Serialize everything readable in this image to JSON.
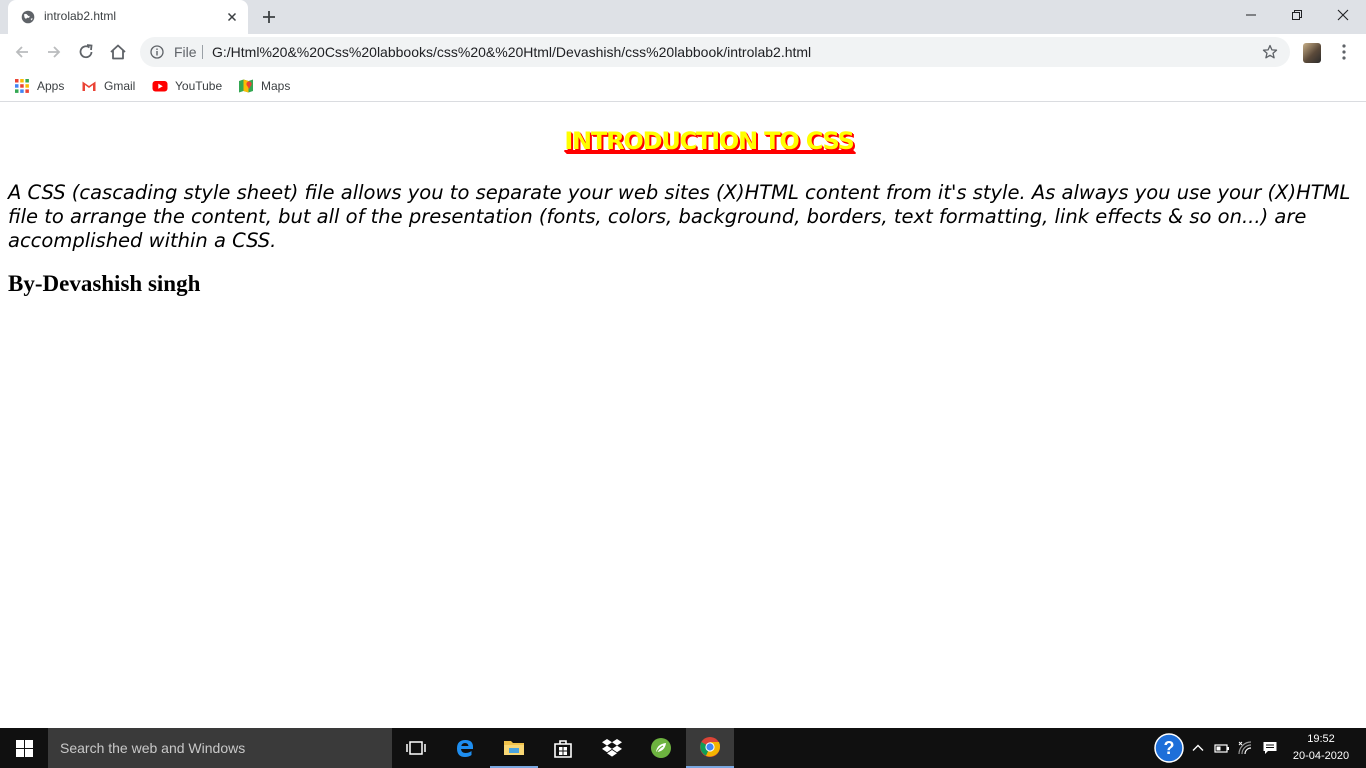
{
  "browser": {
    "tab": {
      "title": "introlab2.html"
    },
    "omnibox": {
      "scheme_label": "File",
      "url": "G:/Html%20&%20Css%20labbooks/css%20&%20Html/Devashish/css%20labbook/introlab2.html"
    },
    "bookmarks": [
      {
        "label": "Apps",
        "icon": "apps-grid-icon"
      },
      {
        "label": "Gmail",
        "icon": "gmail-icon"
      },
      {
        "label": "YouTube",
        "icon": "youtube-icon"
      },
      {
        "label": "Maps",
        "icon": "maps-icon"
      }
    ]
  },
  "page": {
    "heading": "INTRODUCTION TO CSS",
    "intro": "A CSS (cascading style sheet) file allows you to separate your web sites (X)HTML content from it's style. As always you use your (X)HTML file to arrange the content, but all of the presentation (fonts, colors, background, borders, text formatting, link effects & so on...) are accomplished within a CSS.",
    "author": "By-Devashish singh",
    "heading_colors": {
      "text": "#ffff00",
      "shadow_underline": "#ff0000"
    }
  },
  "taskbar": {
    "search_placeholder": "Search the web and Windows",
    "apps": [
      "task-view",
      "edge",
      "file-explorer",
      "store",
      "dropbox",
      "spring",
      "chrome"
    ],
    "clock": {
      "time": "19:52",
      "date": "20-04-2020"
    }
  }
}
